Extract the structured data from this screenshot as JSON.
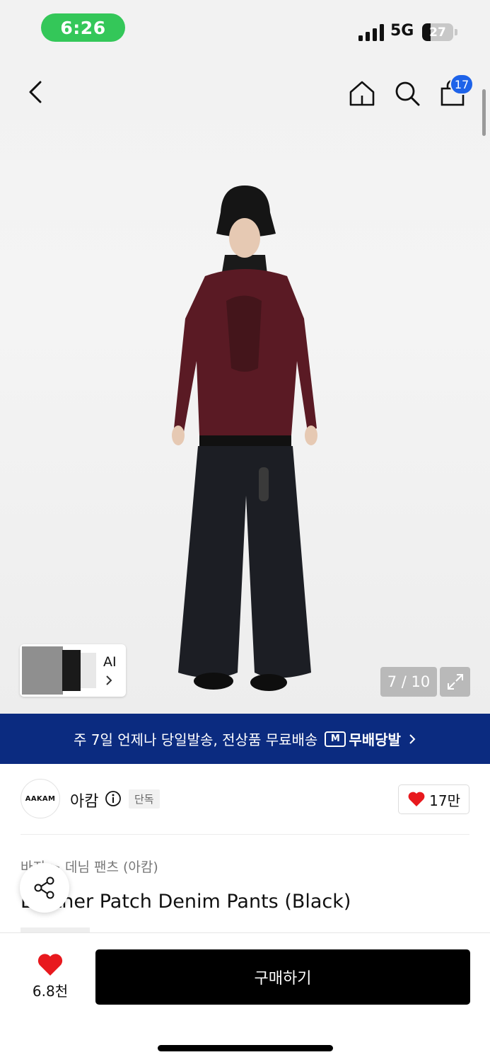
{
  "status_bar": {
    "time": "6:26",
    "network": "5G",
    "battery_level": "27",
    "battery_fraction": 0.27
  },
  "header": {
    "back_icon": "chevron-left-icon",
    "home_icon": "home-icon",
    "search_icon": "search-icon",
    "cart_icon": "shopping-bag-icon",
    "cart_count": "17"
  },
  "gallery": {
    "ai_label": "AI",
    "counter": "7 / 10",
    "current_image": 7,
    "total_images": 10,
    "expand_icon": "expand-icon"
  },
  "shipping_banner": {
    "text": "주 7일 언제나 당일발송, 전상품 무료배송",
    "logo_mark": "M",
    "logo_text": "무배당발"
  },
  "brand": {
    "logo_text": "AAKAM",
    "name": "아캄",
    "badge": "단독",
    "likes": "17만"
  },
  "product": {
    "breadcrumb": "바지 > 데님 팬츠 (아캄)",
    "title": "Leather Patch Denim Pants (Black)"
  },
  "bottom_bar": {
    "wish_count": "6.8천",
    "buy_label": "구매하기"
  },
  "colors": {
    "accent_green": "#34c759",
    "badge_blue": "#1e63e9",
    "banner_navy": "#0b2b80",
    "heart_red": "#e8191e",
    "buy_black": "#000000"
  }
}
